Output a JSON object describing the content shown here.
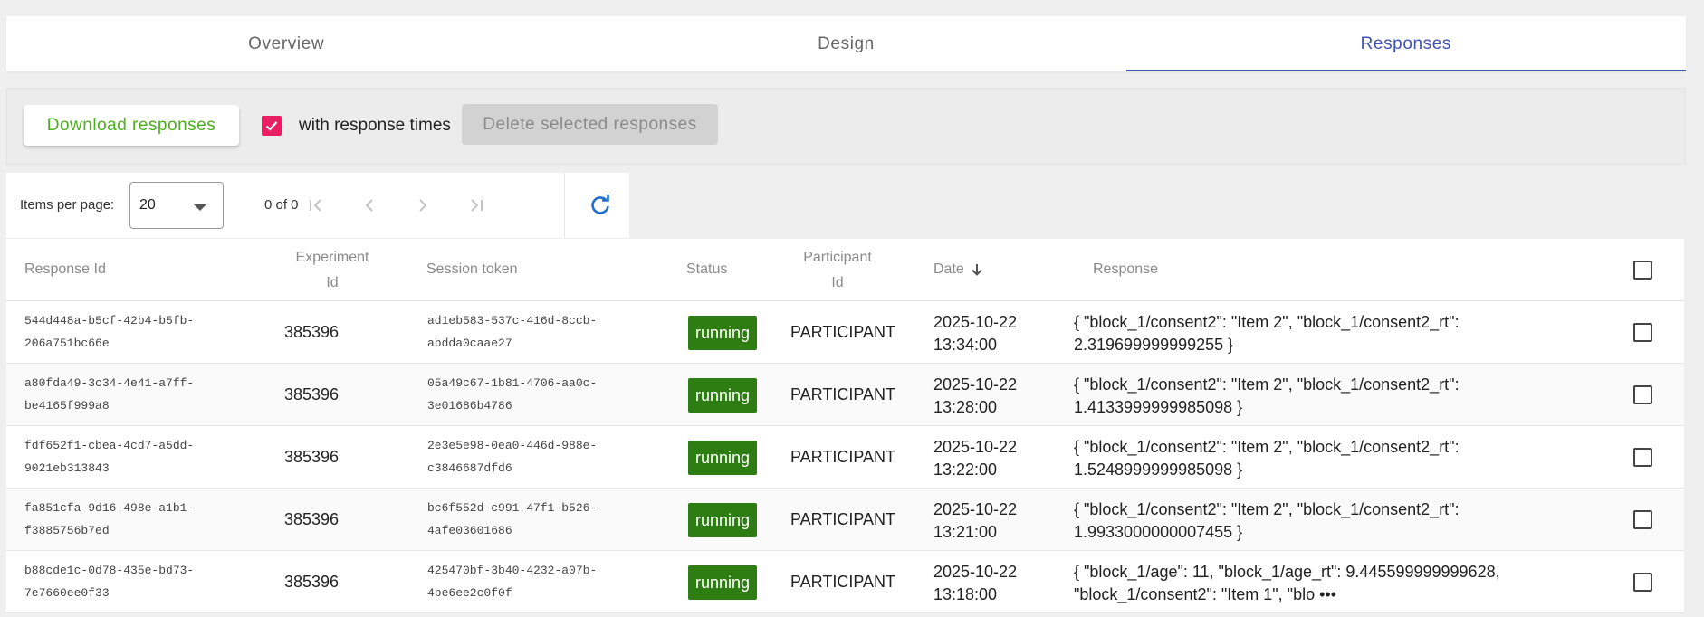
{
  "tabs": [
    {
      "label": "Overview",
      "active": false
    },
    {
      "label": "Design",
      "active": false
    },
    {
      "label": "Responses",
      "active": true
    }
  ],
  "toolbar": {
    "download_label": "Download responses",
    "with_times_label": "with response times",
    "with_times_checked": true,
    "delete_label": "Delete selected responses"
  },
  "paginator": {
    "items_per_page_label": "Items per page:",
    "page_size": "20",
    "range": "0 of 0"
  },
  "table": {
    "headers": {
      "response_id": "Response Id",
      "experiment_id_1": "Experiment",
      "experiment_id_2": "Id",
      "session_token": "Session token",
      "status": "Status",
      "participant_id_1": "Participant",
      "participant_id_2": "Id",
      "date": "Date",
      "response": "Response"
    },
    "rows": [
      {
        "response_id": "544d448a-b5cf-42b4-b5fb-\n206a751bc66e",
        "experiment_id": "385396",
        "session_token": "ad1eb583-537c-416d-8ccb-\nabdda0caae27",
        "status": "running",
        "participant_id": "PARTICIPANT",
        "date": "2025-10-22\n13:34:00",
        "response": "{ \"block_1/consent2\": \"Item 2\", \"block_1/consent2_rt\":\n2.319699999999255 }"
      },
      {
        "response_id": "a80fda49-3c34-4e41-a7ff-\nbe4165f999a8",
        "experiment_id": "385396",
        "session_token": "05a49c67-1b81-4706-aa0c-\n3e01686b4786",
        "status": "running",
        "participant_id": "PARTICIPANT",
        "date": "2025-10-22\n13:28:00",
        "response": "{ \"block_1/consent2\": \"Item 2\", \"block_1/consent2_rt\":\n1.4133999999985098 }"
      },
      {
        "response_id": "fdf652f1-cbea-4cd7-a5dd-\n9021eb313843",
        "experiment_id": "385396",
        "session_token": "2e3e5e98-0ea0-446d-988e-\nc3846687dfd6",
        "status": "running",
        "participant_id": "PARTICIPANT",
        "date": "2025-10-22\n13:22:00",
        "response": "{ \"block_1/consent2\": \"Item 2\", \"block_1/consent2_rt\":\n1.5248999999985098 }"
      },
      {
        "response_id": "fa851cfa-9d16-498e-a1b1-\nf3885756b7ed",
        "experiment_id": "385396",
        "session_token": "bc6f552d-c991-47f1-b526-\n4afe03601686",
        "status": "running",
        "participant_id": "PARTICIPANT",
        "date": "2025-10-22\n13:21:00",
        "response": "{ \"block_1/consent2\": \"Item 2\", \"block_1/consent2_rt\":\n1.9933000000007455 }"
      },
      {
        "response_id": "b88cde1c-0d78-435e-bd73-\n7e7660ee0f33",
        "experiment_id": "385396",
        "session_token": "425470bf-3b40-4232-a07b-\n4be6ee2c0f0f",
        "status": "running",
        "participant_id": "PARTICIPANT",
        "date": "2025-10-22\n13:18:00",
        "response": "{ \"block_1/age\": 11, \"block_1/age_rt\": 9.445599999999628,\n\"block_1/consent2\": \"Item 1\", \"blo •••"
      }
    ]
  },
  "colors": {
    "accent": "#3f51b5",
    "download": "#4caf1e",
    "checkbox": "#e91e63",
    "running": "#2e7d12",
    "refresh": "#1e6fd0"
  },
  "icons": [
    "check-icon",
    "caret-down-icon",
    "first-page-icon",
    "previous-page-icon",
    "next-page-icon",
    "last-page-icon",
    "refresh-icon",
    "arrow-down-icon"
  ]
}
